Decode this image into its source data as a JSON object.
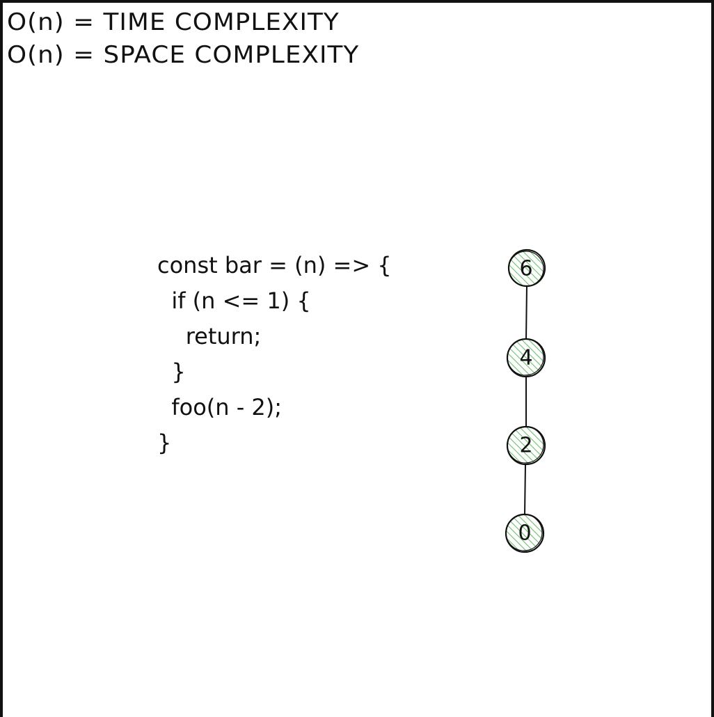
{
  "headings": {
    "time": "O(n) = TIME COMPLEXITY",
    "space": "O(n) = SPACE COMPLEXITY"
  },
  "code": {
    "lines": [
      "const bar = (n) => {",
      "  if (n <= 1) {",
      "    return;",
      "  }",
      "  foo(n - 2);",
      "}"
    ]
  },
  "recursion_tree": {
    "node_fill": "#8fd18f",
    "stroke": "#111111",
    "nodes": [
      "6",
      "4",
      "2",
      "0"
    ]
  }
}
